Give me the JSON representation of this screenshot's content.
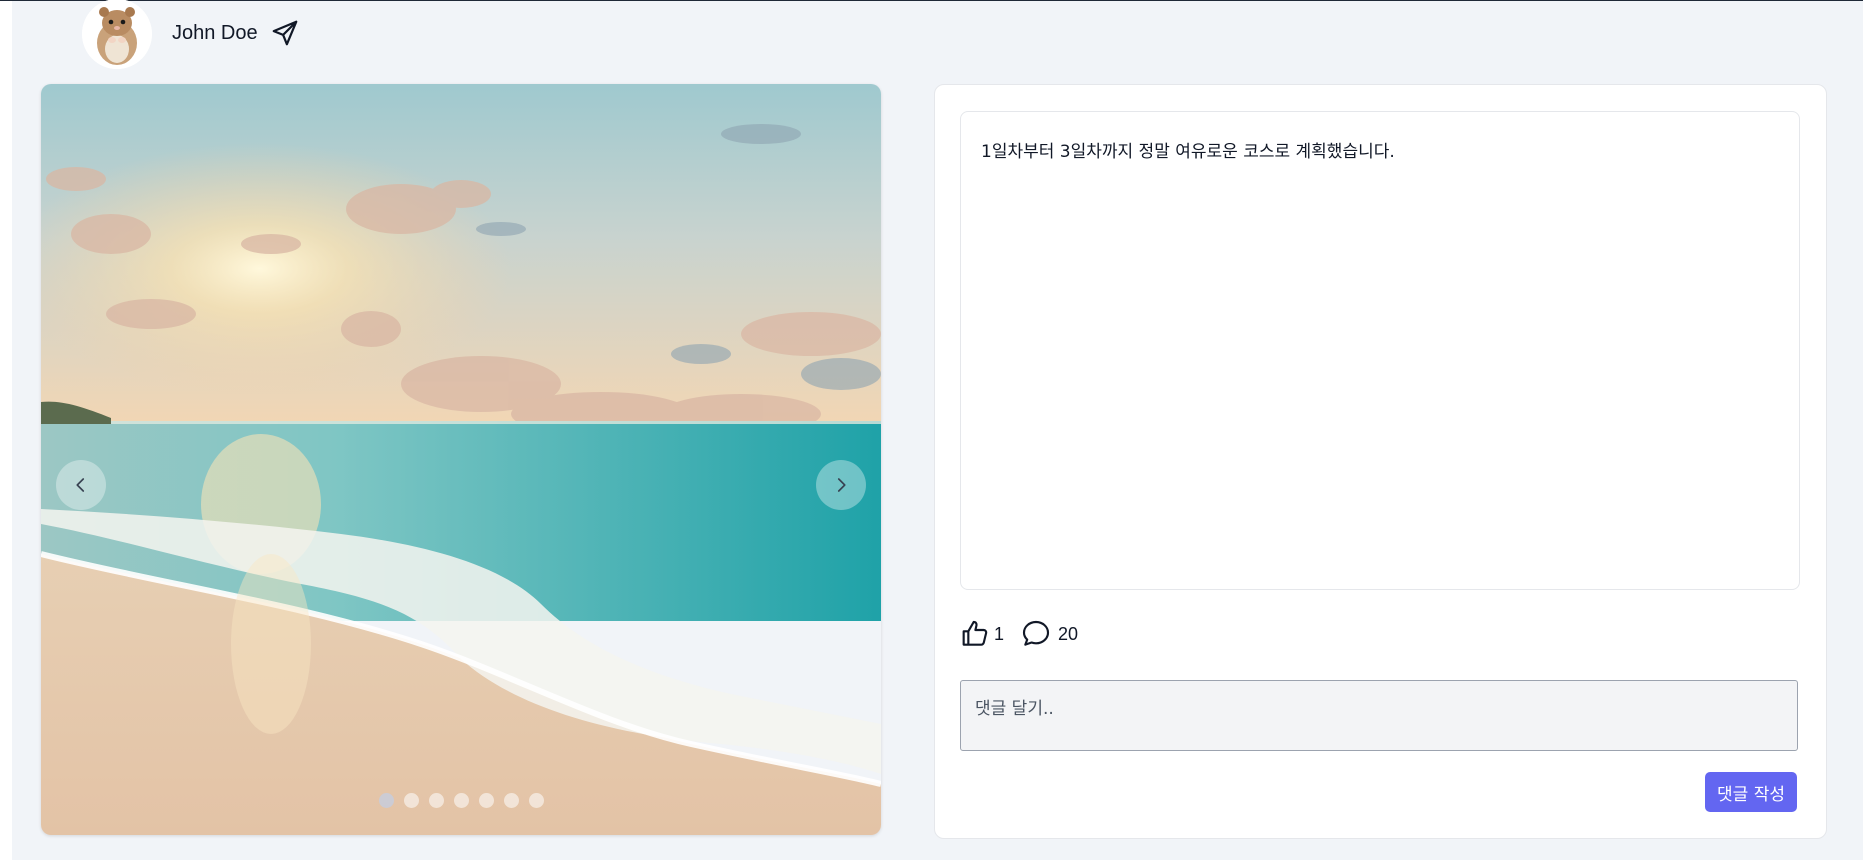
{
  "user": {
    "name": "John Doe",
    "avatar_icon": "hamster-avatar",
    "send_icon": "paper-plane-icon"
  },
  "carousel": {
    "image_description_icon": "beach-sunset-photo",
    "prev_icon": "chevron-left-icon",
    "next_icon": "chevron-right-icon",
    "slide_count": 7,
    "active_index": 0
  },
  "post": {
    "content": "1일차부터 3일차까지 정말 여유로운 코스로 계획했습니다.",
    "likes": "1",
    "comments": "20",
    "like_icon": "thumbs-up-icon",
    "comment_icon": "speech-bubble-icon"
  },
  "comment_form": {
    "placeholder": "댓글 달기..",
    "submit_label": "댓글 작성"
  },
  "colors": {
    "accent": "#6366f1",
    "page_bg": "#f1f4f8",
    "panel_bg": "#ffffff"
  }
}
